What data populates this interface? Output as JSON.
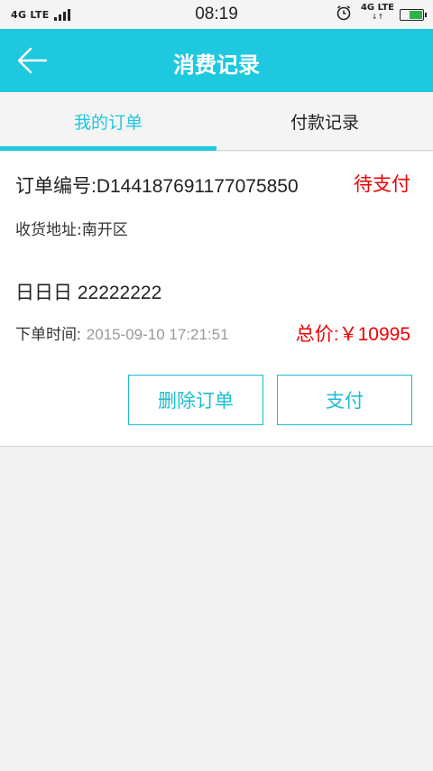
{
  "status_bar": {
    "network_left": "4G LTE",
    "time": "08:19",
    "network_right": "4G LTE",
    "network_right_arrows": "↓↑",
    "battery_level": 0.55,
    "alarm_icon": "alarm-clock-icon"
  },
  "header": {
    "title": "消费记录",
    "back_icon": "arrow-left-icon"
  },
  "tabs": [
    {
      "label": "我的订单",
      "active": true
    },
    {
      "label": "付款记录",
      "active": false
    }
  ],
  "order": {
    "number": "订单编号:D144187691177075850",
    "status": "待支付",
    "address": "收货地址:南开区",
    "product": "日日日  22222222",
    "time_label": "下单时间:",
    "time_value": "2015-09-10 17:21:51",
    "total": "总价:￥10995",
    "delete_label": "删除订单",
    "pay_label": "支付"
  },
  "colors": {
    "accent": "#1ec8df",
    "status_red": "#e00000",
    "background": "#f2f2f2"
  }
}
